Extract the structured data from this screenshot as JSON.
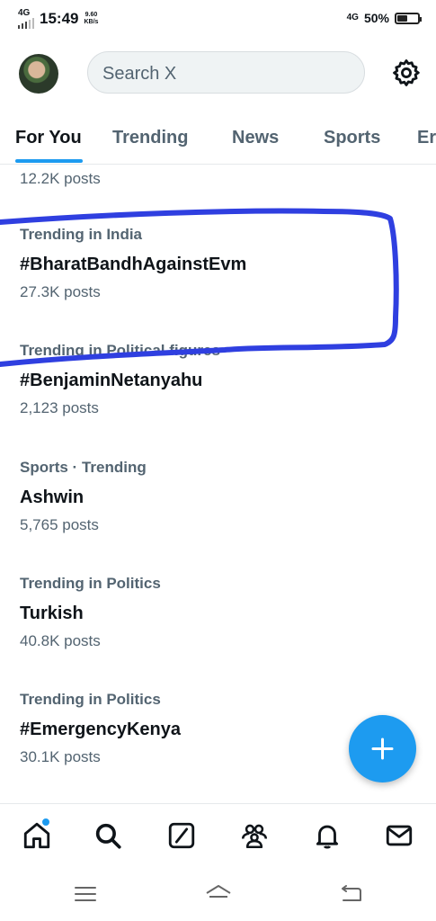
{
  "status_bar": {
    "network": "4G",
    "time": "15:49",
    "speed_value": "9.60",
    "speed_unit": "KB/s",
    "network_right": "4G",
    "battery_text": "50%",
    "battery_level": 0.5
  },
  "header": {
    "search_placeholder": "Search X"
  },
  "tabs": [
    {
      "label": "For You",
      "active": true
    },
    {
      "label": "Trending",
      "active": false
    },
    {
      "label": "News",
      "active": false
    },
    {
      "label": "Sports",
      "active": false
    },
    {
      "label": "Er",
      "active": false
    }
  ],
  "feed": {
    "partial_posts": "12.2K posts",
    "trends": [
      {
        "context": "Trending in India",
        "title": "#BharatBandhAgainstEvm",
        "posts": "27.3K posts"
      },
      {
        "context": "Trending in Political figures",
        "title": "#BenjaminNetanyahu",
        "posts": "2,123 posts"
      },
      {
        "context": "Sports · Trending",
        "title": "Ashwin",
        "posts": "5,765 posts"
      },
      {
        "context": "Trending in Politics",
        "title": "Turkish",
        "posts": "40.8K posts"
      },
      {
        "context": "Trending in Politics",
        "title": "#EmergencyKenya",
        "posts": "30.1K posts"
      }
    ]
  },
  "fab": {
    "icon": "plus-icon"
  },
  "bottom_nav": {
    "items": [
      "home-icon",
      "search-icon",
      "grok-icon",
      "communities-icon",
      "notifications-icon",
      "messages-icon"
    ],
    "home_has_badge": true
  },
  "system_nav": {
    "items": [
      "menu-icon",
      "home-icon",
      "back-icon"
    ]
  },
  "colors": {
    "accent": "#1d9bf0",
    "annotation": "#2f3fe0",
    "text_primary": "#0f1419",
    "text_secondary": "#536471"
  }
}
